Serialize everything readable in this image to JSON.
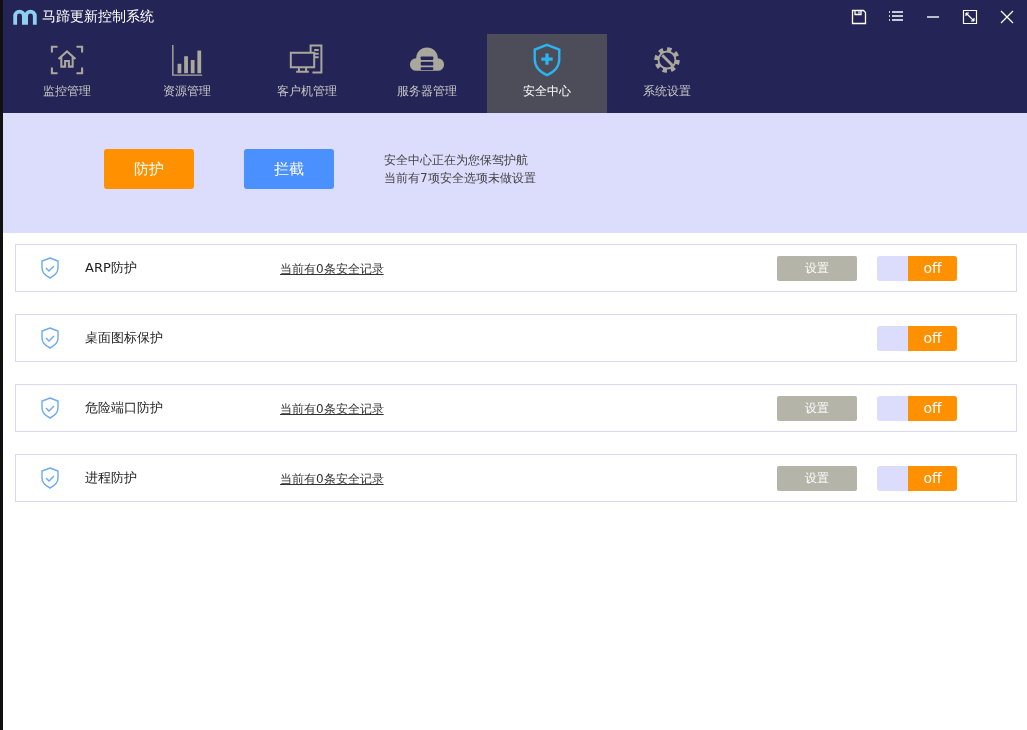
{
  "window": {
    "title": "马蹄更新控制系统"
  },
  "tabs": [
    {
      "label": "监控管理",
      "kind": "monitor",
      "selected": false
    },
    {
      "label": "资源管理",
      "kind": "resource",
      "selected": false
    },
    {
      "label": "客户机管理",
      "kind": "client",
      "selected": false
    },
    {
      "label": "服务器管理",
      "kind": "server",
      "selected": false
    },
    {
      "label": "安全中心",
      "kind": "security",
      "selected": true
    },
    {
      "label": "系统设置",
      "kind": "settings",
      "selected": false
    }
  ],
  "banner": {
    "buttons": [
      {
        "label": "防护",
        "kind": "protect"
      },
      {
        "label": "拦截",
        "kind": "block"
      }
    ],
    "lines": [
      "安全中心正在为您保驾护航",
      "当前有7项安全选项未做设置"
    ]
  },
  "rows": [
    {
      "name": "ARP防护",
      "records": "当前有0条安全记录",
      "settings": "设置",
      "toggle": "off",
      "on": false
    },
    {
      "name": "桌面图标保护",
      "toggle": "off",
      "on": false
    },
    {
      "name": "危险端口防护",
      "records": "当前有0条安全记录",
      "settings": "设置",
      "toggle": "off",
      "on": false
    },
    {
      "name": "进程防护",
      "records": "当前有0条安全记录",
      "settings": "设置",
      "toggle": "off",
      "on": false
    }
  ]
}
